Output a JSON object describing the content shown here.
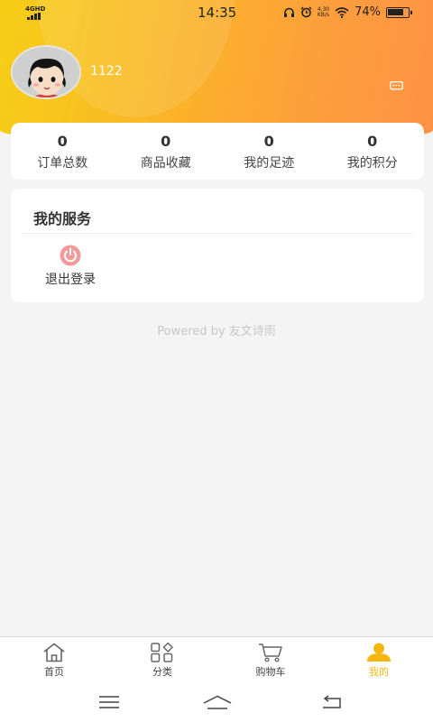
{
  "status_bar": {
    "network": "4GHD",
    "time": "14:35",
    "speed_top": "4.30",
    "speed_bottom": "KB/s",
    "battery": "74%"
  },
  "profile": {
    "username": "1122"
  },
  "stats": [
    {
      "value": "0",
      "label": "订单总数"
    },
    {
      "value": "0",
      "label": "商品收藏"
    },
    {
      "value": "0",
      "label": "我的足迹"
    },
    {
      "value": "0",
      "label": "我的积分"
    }
  ],
  "services": {
    "title": "我的服务",
    "items": [
      {
        "label": "退出登录",
        "icon": "power-icon"
      }
    ]
  },
  "footer": {
    "powered": "Powered by 友文诗雨"
  },
  "tabbar": [
    {
      "label": "首页",
      "icon": "home-icon"
    },
    {
      "label": "分类",
      "icon": "category-icon"
    },
    {
      "label": "购物车",
      "icon": "cart-icon"
    },
    {
      "label": "我的",
      "icon": "user-icon",
      "active": true
    }
  ],
  "colors": {
    "accent": "#f6b710",
    "header_start": "#f6cf16",
    "header_end": "#fe9244"
  }
}
